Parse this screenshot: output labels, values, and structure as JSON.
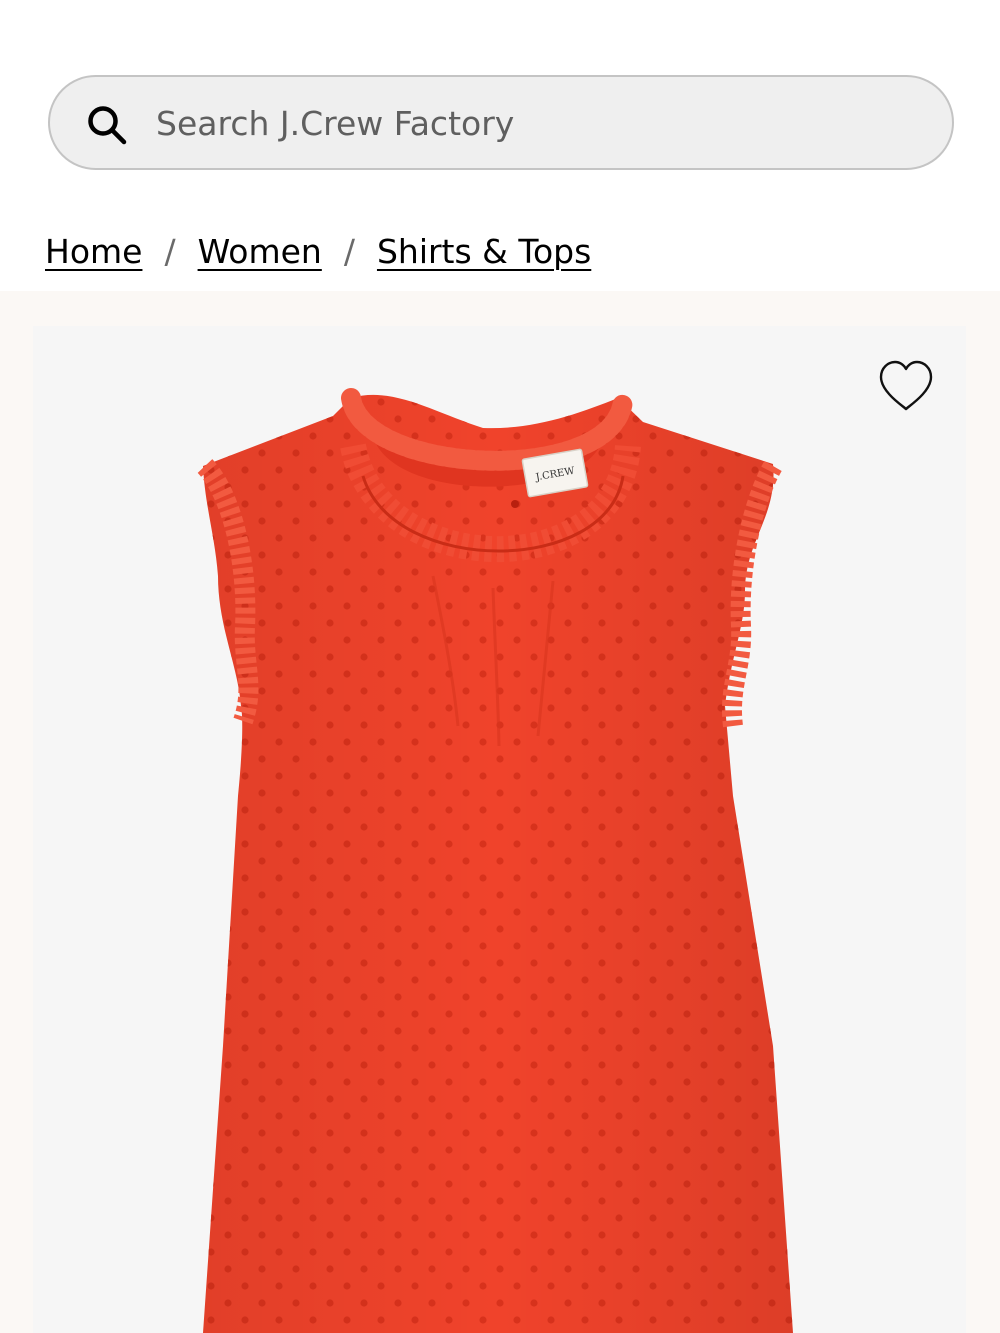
{
  "search": {
    "placeholder": "Search J.Crew Factory",
    "icon": "search-icon"
  },
  "breadcrumb": {
    "items": [
      "Home",
      "Women",
      "Shirts & Tops"
    ],
    "separator": "/"
  },
  "product": {
    "image": {
      "garment_color": "#f0432b",
      "label_text": "J.CREW"
    },
    "wishlist_icon": "heart-outline-icon"
  },
  "colors": {
    "gallery_background": "#fbf8f5",
    "frame_background": "#f6f6f6",
    "search_background": "#efefef"
  }
}
